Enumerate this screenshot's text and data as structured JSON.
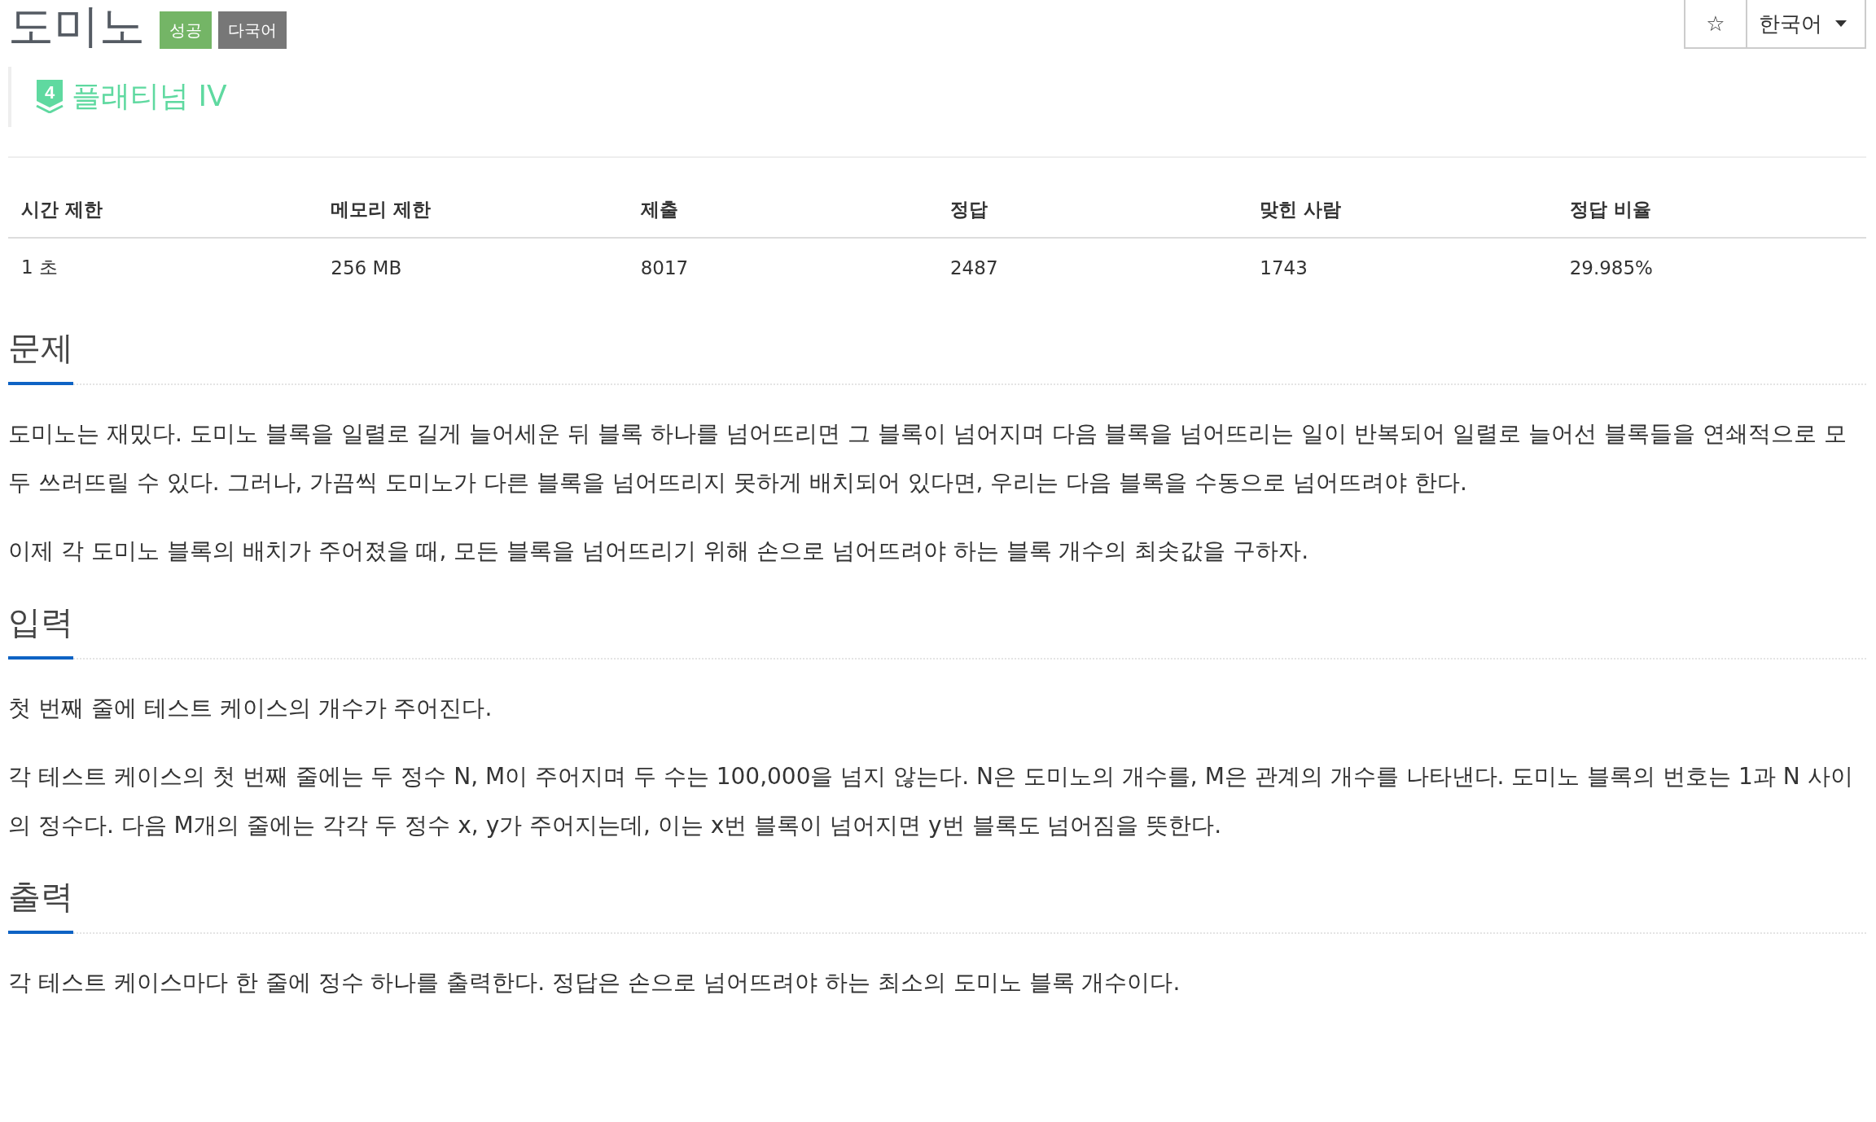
{
  "title": "도미노",
  "badges": [
    {
      "label": "성공",
      "color": "#74b566"
    },
    {
      "label": "다국어",
      "color": "#777777"
    }
  ],
  "tier": {
    "number": "4",
    "label": "플래티넘 IV"
  },
  "toolbar": {
    "star": "☆",
    "language": "한국어"
  },
  "table": {
    "columns": [
      "시간 제한",
      "메모리 제한",
      "제출",
      "정답",
      "맞힌 사람",
      "정답 비율"
    ],
    "rows": [
      [
        "1 초",
        "256 MB",
        "8017",
        "2487",
        "1743",
        "29.985%"
      ]
    ]
  },
  "sections": [
    {
      "heading": "문제",
      "paragraphs": [
        "도미노는 재밌다. 도미노 블록을 일렬로 길게 늘어세운 뒤 블록 하나를 넘어뜨리면 그 블록이 넘어지며 다음 블록을 넘어뜨리는 일이 반복되어 일렬로 늘어선 블록들을 연쇄적으로 모두 쓰러뜨릴 수 있다. 그러나, 가끔씩 도미노가 다른 블록을 넘어뜨리지 못하게 배치되어 있다면, 우리는 다음 블록을 수동으로 넘어뜨려야 한다.",
        "이제 각 도미노 블록의 배치가 주어졌을 때, 모든 블록을 넘어뜨리기 위해 손으로 넘어뜨려야 하는 블록 개수의 최솟값을 구하자."
      ]
    },
    {
      "heading": "입력",
      "paragraphs": [
        "첫 번째 줄에 테스트 케이스의 개수가 주어진다.",
        "각 테스트 케이스의 첫 번째 줄에는 두 정수 N, M이 주어지며 두 수는 100,000을 넘지 않는다. N은 도미노의 개수를, M은 관계의 개수를 나타낸다. 도미노 블록의 번호는 1과 N 사이의 정수다. 다음 M개의 줄에는 각각 두 정수 x, y가 주어지는데, 이는 x번 블록이 넘어지면 y번 블록도 넘어짐을 뜻한다."
      ]
    },
    {
      "heading": "출력",
      "paragraphs": [
        "각 테스트 케이스마다 한 줄에 정수 하나를 출력한다. 정답은 손으로 넘어뜨려야 하는 최소의 도미노 블록 개수이다."
      ]
    }
  ]
}
